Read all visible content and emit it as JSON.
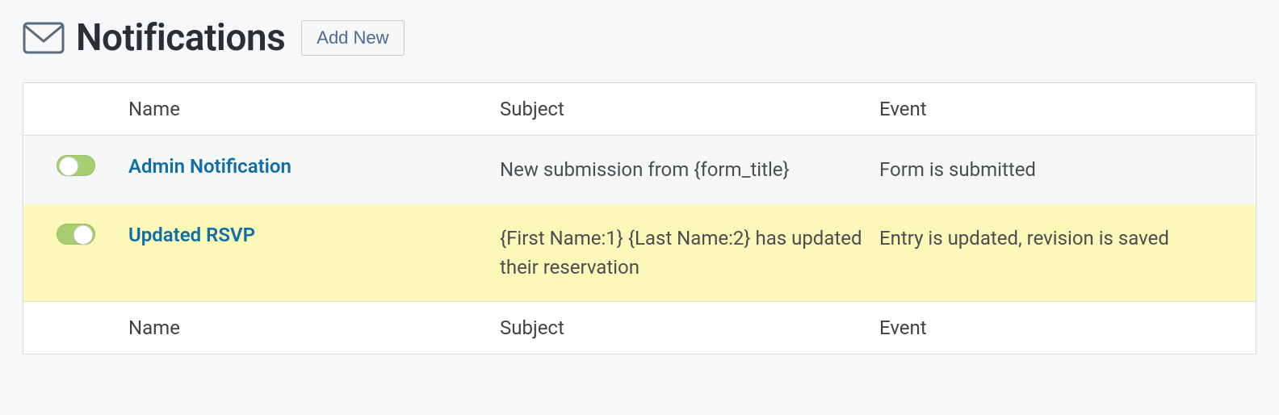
{
  "header": {
    "title": "Notifications",
    "add_new_label": "Add New"
  },
  "columns": {
    "name": "Name",
    "subject": "Subject",
    "event": "Event"
  },
  "rows": [
    {
      "name": "Admin Notification",
      "subject": "New submission from {form_title}",
      "event": "Form is submitted",
      "enabled": true,
      "highlight": false
    },
    {
      "name": "Updated RSVP",
      "subject": "{First Name:1} {Last Name:2} has updated their reservation",
      "event": "Entry is updated, revision is saved",
      "enabled": true,
      "highlight": true
    }
  ]
}
